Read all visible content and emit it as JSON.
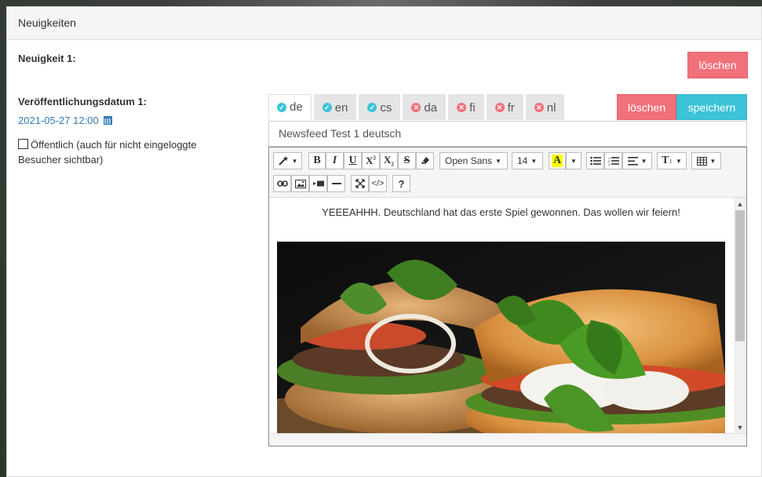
{
  "panel": {
    "title": "Neuigkeiten"
  },
  "news": {
    "heading": "Neuigkeit 1:",
    "delete_label": "löschen",
    "date_label": "Veröffentlichungsdatum 1:",
    "date_value": "2021-05-27 12:00",
    "public_label": "Öffentlich (auch für nicht eingeloggte Besucher sichtbar)"
  },
  "tabs": [
    {
      "label": "de",
      "status": "ok",
      "active": true
    },
    {
      "label": "en",
      "status": "ok",
      "active": false
    },
    {
      "label": "cs",
      "status": "ok",
      "active": false
    },
    {
      "label": "da",
      "status": "missing",
      "active": false
    },
    {
      "label": "fi",
      "status": "missing",
      "active": false
    },
    {
      "label": "fr",
      "status": "missing",
      "active": false
    },
    {
      "label": "nl",
      "status": "missing",
      "active": false
    }
  ],
  "actions": {
    "delete_label": "löschen",
    "save_label": "speichern"
  },
  "editor": {
    "title_value": "Newsfeed Test 1 deutsch",
    "font_name": "Open Sans",
    "font_size": "14",
    "body_text": "YEEEAHHH. Deutschland hat das erste Spiel gewonnen. Das wollen wir feiern!"
  },
  "colors": {
    "danger": "#f0717a",
    "info": "#3cc3d8",
    "link": "#337ab7",
    "highlight": "#ffff00"
  }
}
